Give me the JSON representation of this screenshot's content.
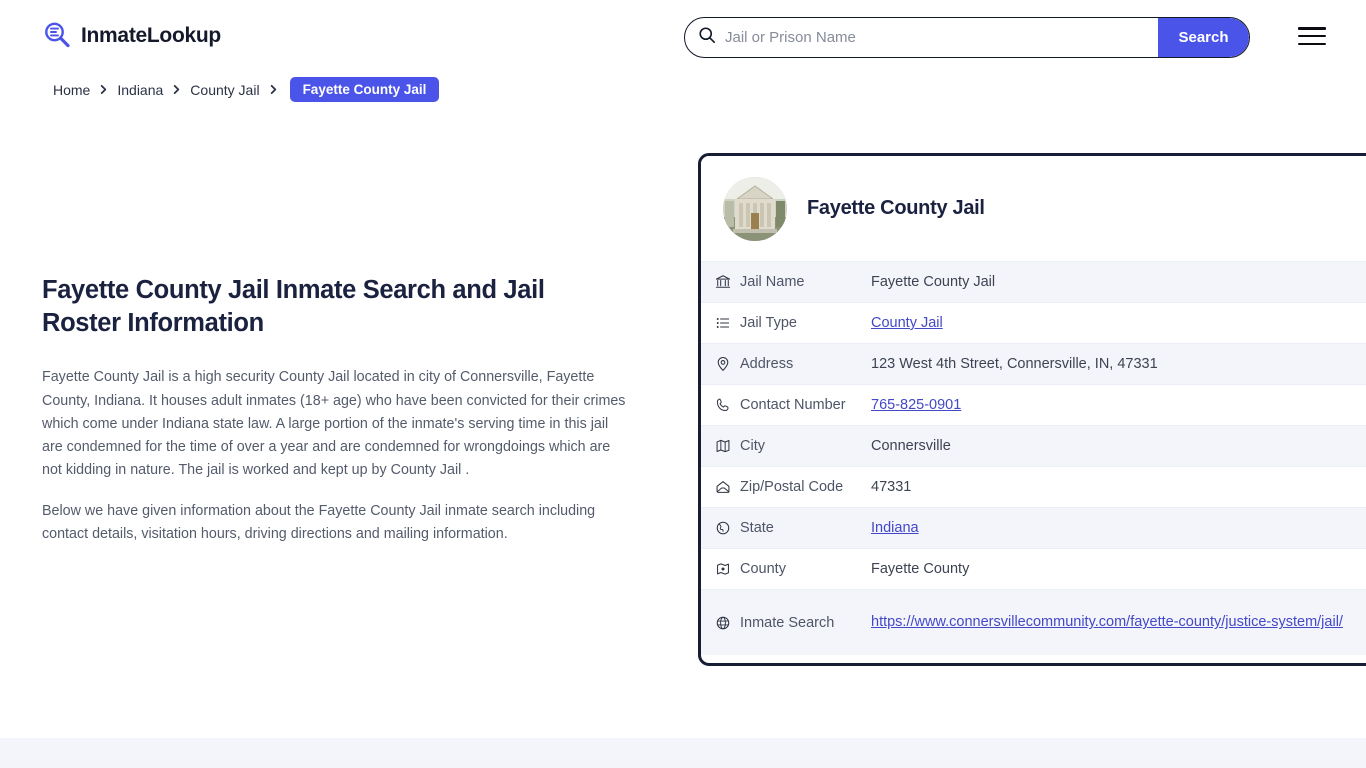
{
  "header": {
    "brand_name": "InmateLookup",
    "brand_icon": "magnifier-logo-icon",
    "menu_icon": "hamburger-menu-icon"
  },
  "search": {
    "icon": "search-icon",
    "placeholder": "Jail or Prison Name",
    "value": "",
    "button_label": "Search"
  },
  "breadcrumb": {
    "items": [
      {
        "label": "Home"
      },
      {
        "label": "Indiana"
      },
      {
        "label": "County Jail"
      }
    ],
    "current": "Fayette County Jail",
    "separator_icon": "chevron-right-icon"
  },
  "article": {
    "heading": "Fayette County Jail Inmate Search and Jail Roster Information",
    "paragraph_1": "Fayette County Jail is a high security County Jail located in city of Connersville, Fayette County, Indiana. It houses adult inmates (18+ age) who have been convicted for their crimes which come under Indiana state law. A large portion of the inmate's serving time in this jail are condemned for the time of over a year and are condemned for wrongdoings which are not kidding in nature. The jail is worked and kept up by County Jail .",
    "paragraph_2": "Below we have given information about the Fayette County Jail inmate search including contact details, visitation hours, driving directions and mailing information."
  },
  "card": {
    "avatar_icon": "courthouse-building-photo",
    "title": "Fayette County Jail",
    "rows": [
      {
        "icon": "bank-icon",
        "label": "Jail Name",
        "value": "Fayette County Jail",
        "link": false
      },
      {
        "icon": "list-icon",
        "label": "Jail Type",
        "value": "County Jail",
        "link": true
      },
      {
        "icon": "map-pin-icon",
        "label": "Address",
        "value": "123 West 4th Street, Connersville, IN, 47331",
        "link": false
      },
      {
        "icon": "phone-icon",
        "label": "Contact Number",
        "value": "765-825-0901",
        "link": true
      },
      {
        "icon": "map-icon",
        "label": "City",
        "value": "Connersville",
        "link": false
      },
      {
        "icon": "envelope-icon",
        "label": "Zip/Postal Code",
        "value": "47331",
        "link": false
      },
      {
        "icon": "globe-icon",
        "label": "State",
        "value": "Indiana",
        "link": true
      },
      {
        "icon": "county-map-icon",
        "label": "County",
        "value": "Fayette County",
        "link": false
      },
      {
        "icon": "web-globe-icon",
        "label": "Inmate Search",
        "value": "https://www.connersvillecommunity.com/fayette-county/justice-system/jail/",
        "link": true
      }
    ]
  },
  "colors": {
    "accent_blue": "#4b54e8",
    "link_blue": "#4248c8",
    "dark_navy": "#161d35",
    "row_alt": "#f4f5fb"
  }
}
